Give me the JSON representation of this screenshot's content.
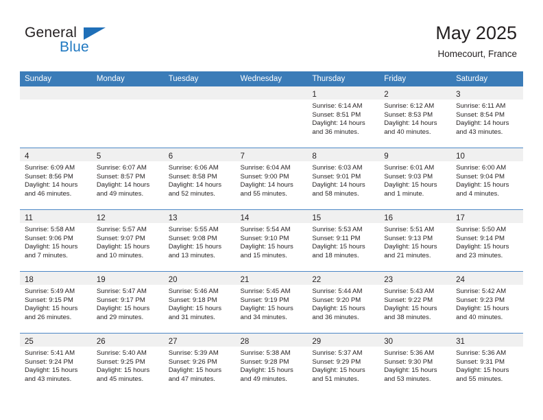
{
  "brand": {
    "word_general": "General",
    "word_blue": "Blue",
    "mark": "triangle-logo"
  },
  "header": {
    "title": "May 2025",
    "location": "Homecourt, France"
  },
  "colors": {
    "header_blue": "#3b7cb8",
    "row_divider": "#4a86c5",
    "daynum_band": "#f0f0f0",
    "brand_blue": "#1f78c1",
    "text": "#231f20"
  },
  "weekday_headers": [
    "Sunday",
    "Monday",
    "Tuesday",
    "Wednesday",
    "Thursday",
    "Friday",
    "Saturday"
  ],
  "weeks": [
    [
      {
        "day": "",
        "sunrise": "",
        "sunset": "",
        "daylight_1": "",
        "daylight_2": ""
      },
      {
        "day": "",
        "sunrise": "",
        "sunset": "",
        "daylight_1": "",
        "daylight_2": ""
      },
      {
        "day": "",
        "sunrise": "",
        "sunset": "",
        "daylight_1": "",
        "daylight_2": ""
      },
      {
        "day": "",
        "sunrise": "",
        "sunset": "",
        "daylight_1": "",
        "daylight_2": ""
      },
      {
        "day": "1",
        "sunrise": "Sunrise: 6:14 AM",
        "sunset": "Sunset: 8:51 PM",
        "daylight_1": "Daylight: 14 hours",
        "daylight_2": "and 36 minutes."
      },
      {
        "day": "2",
        "sunrise": "Sunrise: 6:12 AM",
        "sunset": "Sunset: 8:53 PM",
        "daylight_1": "Daylight: 14 hours",
        "daylight_2": "and 40 minutes."
      },
      {
        "day": "3",
        "sunrise": "Sunrise: 6:11 AM",
        "sunset": "Sunset: 8:54 PM",
        "daylight_1": "Daylight: 14 hours",
        "daylight_2": "and 43 minutes."
      }
    ],
    [
      {
        "day": "4",
        "sunrise": "Sunrise: 6:09 AM",
        "sunset": "Sunset: 8:56 PM",
        "daylight_1": "Daylight: 14 hours",
        "daylight_2": "and 46 minutes."
      },
      {
        "day": "5",
        "sunrise": "Sunrise: 6:07 AM",
        "sunset": "Sunset: 8:57 PM",
        "daylight_1": "Daylight: 14 hours",
        "daylight_2": "and 49 minutes."
      },
      {
        "day": "6",
        "sunrise": "Sunrise: 6:06 AM",
        "sunset": "Sunset: 8:58 PM",
        "daylight_1": "Daylight: 14 hours",
        "daylight_2": "and 52 minutes."
      },
      {
        "day": "7",
        "sunrise": "Sunrise: 6:04 AM",
        "sunset": "Sunset: 9:00 PM",
        "daylight_1": "Daylight: 14 hours",
        "daylight_2": "and 55 minutes."
      },
      {
        "day": "8",
        "sunrise": "Sunrise: 6:03 AM",
        "sunset": "Sunset: 9:01 PM",
        "daylight_1": "Daylight: 14 hours",
        "daylight_2": "and 58 minutes."
      },
      {
        "day": "9",
        "sunrise": "Sunrise: 6:01 AM",
        "sunset": "Sunset: 9:03 PM",
        "daylight_1": "Daylight: 15 hours",
        "daylight_2": "and 1 minute."
      },
      {
        "day": "10",
        "sunrise": "Sunrise: 6:00 AM",
        "sunset": "Sunset: 9:04 PM",
        "daylight_1": "Daylight: 15 hours",
        "daylight_2": "and 4 minutes."
      }
    ],
    [
      {
        "day": "11",
        "sunrise": "Sunrise: 5:58 AM",
        "sunset": "Sunset: 9:06 PM",
        "daylight_1": "Daylight: 15 hours",
        "daylight_2": "and 7 minutes."
      },
      {
        "day": "12",
        "sunrise": "Sunrise: 5:57 AM",
        "sunset": "Sunset: 9:07 PM",
        "daylight_1": "Daylight: 15 hours",
        "daylight_2": "and 10 minutes."
      },
      {
        "day": "13",
        "sunrise": "Sunrise: 5:55 AM",
        "sunset": "Sunset: 9:08 PM",
        "daylight_1": "Daylight: 15 hours",
        "daylight_2": "and 13 minutes."
      },
      {
        "day": "14",
        "sunrise": "Sunrise: 5:54 AM",
        "sunset": "Sunset: 9:10 PM",
        "daylight_1": "Daylight: 15 hours",
        "daylight_2": "and 15 minutes."
      },
      {
        "day": "15",
        "sunrise": "Sunrise: 5:53 AM",
        "sunset": "Sunset: 9:11 PM",
        "daylight_1": "Daylight: 15 hours",
        "daylight_2": "and 18 minutes."
      },
      {
        "day": "16",
        "sunrise": "Sunrise: 5:51 AM",
        "sunset": "Sunset: 9:13 PM",
        "daylight_1": "Daylight: 15 hours",
        "daylight_2": "and 21 minutes."
      },
      {
        "day": "17",
        "sunrise": "Sunrise: 5:50 AM",
        "sunset": "Sunset: 9:14 PM",
        "daylight_1": "Daylight: 15 hours",
        "daylight_2": "and 23 minutes."
      }
    ],
    [
      {
        "day": "18",
        "sunrise": "Sunrise: 5:49 AM",
        "sunset": "Sunset: 9:15 PM",
        "daylight_1": "Daylight: 15 hours",
        "daylight_2": "and 26 minutes."
      },
      {
        "day": "19",
        "sunrise": "Sunrise: 5:47 AM",
        "sunset": "Sunset: 9:17 PM",
        "daylight_1": "Daylight: 15 hours",
        "daylight_2": "and 29 minutes."
      },
      {
        "day": "20",
        "sunrise": "Sunrise: 5:46 AM",
        "sunset": "Sunset: 9:18 PM",
        "daylight_1": "Daylight: 15 hours",
        "daylight_2": "and 31 minutes."
      },
      {
        "day": "21",
        "sunrise": "Sunrise: 5:45 AM",
        "sunset": "Sunset: 9:19 PM",
        "daylight_1": "Daylight: 15 hours",
        "daylight_2": "and 34 minutes."
      },
      {
        "day": "22",
        "sunrise": "Sunrise: 5:44 AM",
        "sunset": "Sunset: 9:20 PM",
        "daylight_1": "Daylight: 15 hours",
        "daylight_2": "and 36 minutes."
      },
      {
        "day": "23",
        "sunrise": "Sunrise: 5:43 AM",
        "sunset": "Sunset: 9:22 PM",
        "daylight_1": "Daylight: 15 hours",
        "daylight_2": "and 38 minutes."
      },
      {
        "day": "24",
        "sunrise": "Sunrise: 5:42 AM",
        "sunset": "Sunset: 9:23 PM",
        "daylight_1": "Daylight: 15 hours",
        "daylight_2": "and 40 minutes."
      }
    ],
    [
      {
        "day": "25",
        "sunrise": "Sunrise: 5:41 AM",
        "sunset": "Sunset: 9:24 PM",
        "daylight_1": "Daylight: 15 hours",
        "daylight_2": "and 43 minutes."
      },
      {
        "day": "26",
        "sunrise": "Sunrise: 5:40 AM",
        "sunset": "Sunset: 9:25 PM",
        "daylight_1": "Daylight: 15 hours",
        "daylight_2": "and 45 minutes."
      },
      {
        "day": "27",
        "sunrise": "Sunrise: 5:39 AM",
        "sunset": "Sunset: 9:26 PM",
        "daylight_1": "Daylight: 15 hours",
        "daylight_2": "and 47 minutes."
      },
      {
        "day": "28",
        "sunrise": "Sunrise: 5:38 AM",
        "sunset": "Sunset: 9:28 PM",
        "daylight_1": "Daylight: 15 hours",
        "daylight_2": "and 49 minutes."
      },
      {
        "day": "29",
        "sunrise": "Sunrise: 5:37 AM",
        "sunset": "Sunset: 9:29 PM",
        "daylight_1": "Daylight: 15 hours",
        "daylight_2": "and 51 minutes."
      },
      {
        "day": "30",
        "sunrise": "Sunrise: 5:36 AM",
        "sunset": "Sunset: 9:30 PM",
        "daylight_1": "Daylight: 15 hours",
        "daylight_2": "and 53 minutes."
      },
      {
        "day": "31",
        "sunrise": "Sunrise: 5:36 AM",
        "sunset": "Sunset: 9:31 PM",
        "daylight_1": "Daylight: 15 hours",
        "daylight_2": "and 55 minutes."
      }
    ]
  ]
}
